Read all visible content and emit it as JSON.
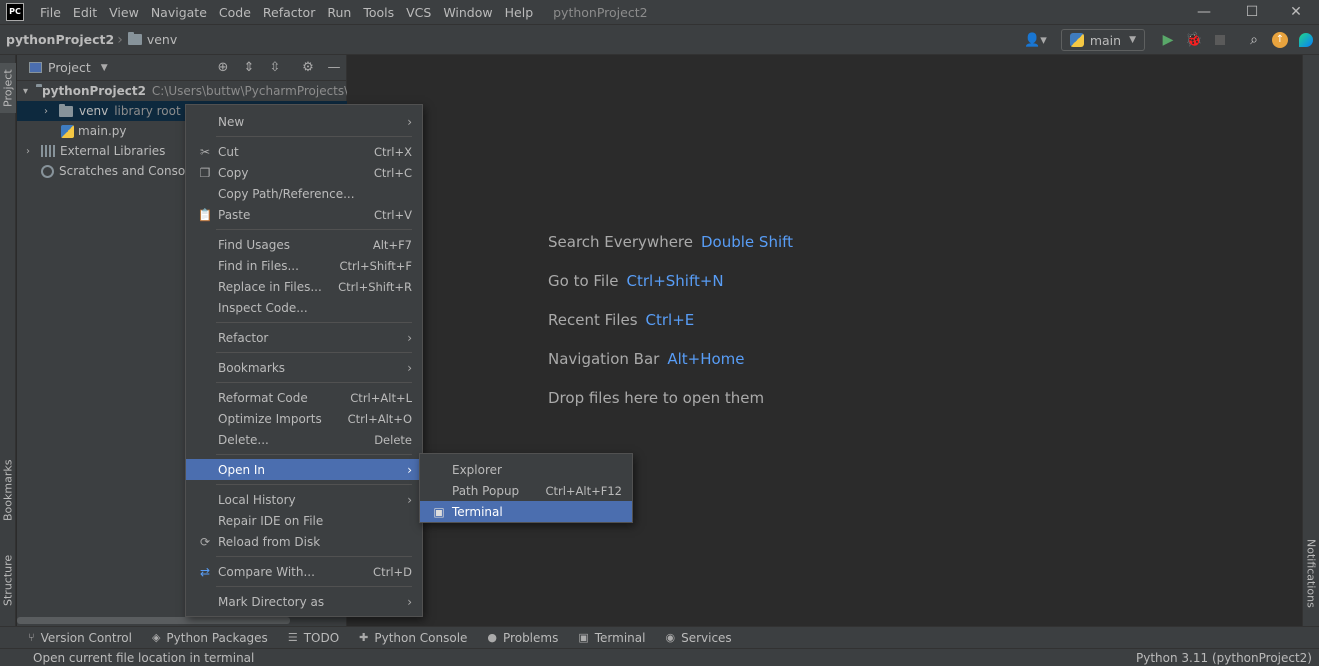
{
  "menubar": {
    "logo": "PC",
    "items": [
      "File",
      "Edit",
      "View",
      "Navigate",
      "Code",
      "Refactor",
      "Run",
      "Tools",
      "VCS",
      "Window",
      "Help"
    ],
    "window_title": "pythonProject2",
    "controls": {
      "minimize": "—",
      "maximize": "☐",
      "close": "✕"
    }
  },
  "navbar": {
    "project": "pythonProject2",
    "folder": "venv",
    "run_config": "main"
  },
  "left_tabs": {
    "project": "Project",
    "bookmarks": "Bookmarks",
    "structure": "Structure"
  },
  "right_tabs": {
    "notifications": "Notifications"
  },
  "project_panel": {
    "title": "Project",
    "tree": {
      "root_name": "pythonProject2",
      "root_path": "C:\\Users\\buttw\\PycharmProjects\\pyt",
      "venv_name": "venv",
      "venv_hint": "library root",
      "main_file": "main.py",
      "external_libraries": "External Libraries",
      "scratches": "Scratches and Consoles"
    }
  },
  "editor_hints": [
    {
      "label": "Search Everywhere",
      "key": "Double Shift"
    },
    {
      "label": "Go to File",
      "key": "Ctrl+Shift+N"
    },
    {
      "label": "Recent Files",
      "key": "Ctrl+E"
    },
    {
      "label": "Navigation Bar",
      "key": "Alt+Home"
    },
    {
      "label": "Drop files here to open them",
      "key": ""
    }
  ],
  "context_menu": {
    "new": "New",
    "cut": "Cut",
    "cut_sc": "Ctrl+X",
    "copy": "Copy",
    "copy_sc": "Ctrl+C",
    "copy_path": "Copy Path/Reference...",
    "paste": "Paste",
    "paste_sc": "Ctrl+V",
    "find_usages": "Find Usages",
    "find_usages_sc": "Alt+F7",
    "find_in_files": "Find in Files...",
    "find_in_files_sc": "Ctrl+Shift+F",
    "replace_in_files": "Replace in Files...",
    "replace_in_files_sc": "Ctrl+Shift+R",
    "inspect_code": "Inspect Code...",
    "refactor": "Refactor",
    "bookmarks": "Bookmarks",
    "reformat_code": "Reformat Code",
    "reformat_code_sc": "Ctrl+Alt+L",
    "optimize_imports": "Optimize Imports",
    "optimize_imports_sc": "Ctrl+Alt+O",
    "delete": "Delete...",
    "delete_sc": "Delete",
    "open_in": "Open In",
    "local_history": "Local History",
    "repair_ide": "Repair IDE on File",
    "reload_disk": "Reload from Disk",
    "compare_with": "Compare With...",
    "compare_with_sc": "Ctrl+D",
    "mark_directory": "Mark Directory as"
  },
  "submenu": {
    "explorer": "Explorer",
    "path_popup": "Path Popup",
    "path_popup_sc": "Ctrl+Alt+F12",
    "terminal": "Terminal"
  },
  "bottom_tabs": [
    "Version Control",
    "Python Packages",
    "TODO",
    "Python Console",
    "Problems",
    "Terminal",
    "Services"
  ],
  "status": {
    "message": "Open current file location in terminal",
    "interpreter": "Python 3.11 (pythonProject2)"
  },
  "colors": {
    "accent": "#4b6eaf",
    "hint_key": "#589df6",
    "panel_bg": "#3c3f41",
    "editor_bg": "#2b2b2b"
  }
}
